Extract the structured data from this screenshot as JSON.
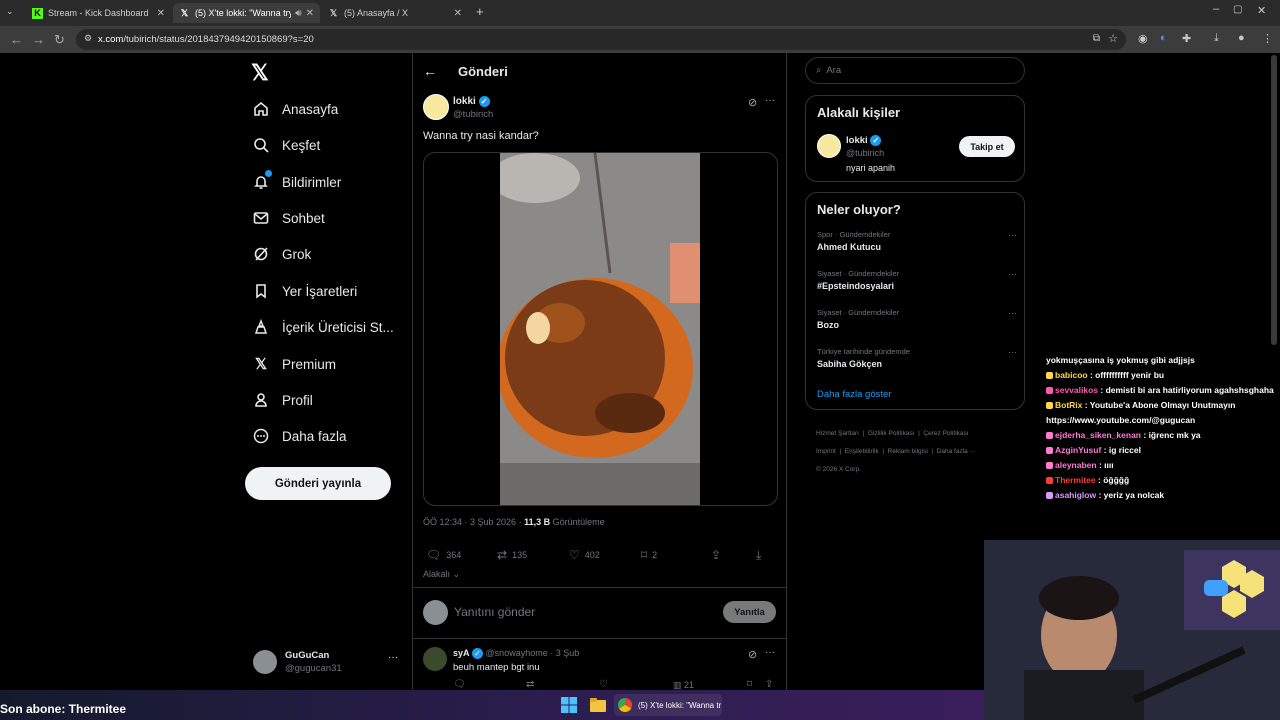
{
  "browser": {
    "tabs": [
      {
        "title": "Stream - Kick Dashboard",
        "active": false,
        "favicon": "kick-icon"
      },
      {
        "title": "(5) X'te lokki: \"Wanna try n",
        "active": true,
        "favicon": "x-icon"
      },
      {
        "title": "(5) Anasayfa / X",
        "active": false,
        "favicon": "x-icon"
      }
    ],
    "url_host": "x.com",
    "url_path": "/tubirich/status/2018437949420150869?s=20"
  },
  "sidebar": {
    "items": [
      {
        "label": "Anasayfa",
        "icon": "home-icon"
      },
      {
        "label": "Keşfet",
        "icon": "search-icon"
      },
      {
        "label": "Bildirimler",
        "icon": "bell-icon"
      },
      {
        "label": "Sohbet",
        "icon": "mail-icon"
      },
      {
        "label": "Grok",
        "icon": "grok-icon"
      },
      {
        "label": "Yer İşaretleri",
        "icon": "bookmark-icon"
      },
      {
        "label": "İçerik Üreticisi St...",
        "icon": "creator-studio-icon"
      },
      {
        "label": "Premium",
        "icon": "x-icon"
      },
      {
        "label": "Profil",
        "icon": "person-icon"
      },
      {
        "label": "Daha fazla",
        "icon": "more-circle-icon"
      }
    ],
    "post_button": "Gönderi yayınla",
    "account": {
      "name": "GuGuCan",
      "handle": "@gugucan31"
    }
  },
  "center": {
    "header": "Gönderi",
    "post": {
      "author": "lokki",
      "handle": "@tubirich",
      "text": "Wanna try nasi kandar?",
      "time": "ÖÖ 12:34 · 3 Şub 2026 · ",
      "views": "11,3 B",
      "views_label": " Görüntüleme",
      "replies": "364",
      "reposts": "135",
      "likes": "402",
      "bookmarks": "2"
    },
    "relevant_label": "Alakalı",
    "reply_placeholder": "Yanıtını gönder",
    "reply_button": "Yanıtla",
    "reply": {
      "author": "syA",
      "handle": "@snowayhome · 3 Şub",
      "text": "beuh mantep bgt inu",
      "views": "21"
    }
  },
  "right": {
    "search_placeholder": "Ara",
    "relevant_people": {
      "title": "Alakalı kişiler",
      "name": "lokki",
      "handle": "@tubirich",
      "bio": "nyari apanih",
      "follow": "Takip et"
    },
    "trends": {
      "title": "Neler oluyor?",
      "items": [
        {
          "category": "Spor · Gündemdekiler",
          "topic": "Ahmed Kutucu"
        },
        {
          "category": "Siyaset · Gündemdekiler",
          "topic": "#Epsteindosyalari"
        },
        {
          "category": "Siyaset · Gündemdekiler",
          "topic": "Bozo"
        },
        {
          "category": "Türkiye tarihinde gündemde",
          "topic": "Sabiha Gökçen"
        }
      ],
      "show_more": "Daha fazla göster"
    },
    "footer": {
      "terms": "Hizmet Şartları",
      "privacy": "Gizlilik Politikası",
      "cookies": "Çerez Politikası",
      "imprint": "Imprint",
      "accessibility": "Erişilebilirlik",
      "ads": "Reklam bilgisi",
      "more": "Daha fazla ···",
      "copyright": "© 2026 X Corp."
    }
  },
  "chat": {
    "messages": [
      {
        "user": "",
        "text": "yokmuşçasına iş yokmuş gibi adjjsjs",
        "color": "#ffffff"
      },
      {
        "user": "babicoo",
        "text": ": offffffffff yenir bu",
        "color": "#ffd84d"
      },
      {
        "user": "sevvalikos",
        "text": ": demisti bi ara hatirliyorum agahshsghaha",
        "color": "#ff5ab0"
      },
      {
        "user": "BotRix",
        "text": ": Youtube'a Abone Olmayı Unutmayın https://www.youtube.com/@gugucan",
        "color": "#ffd84d"
      },
      {
        "user": "ejderha_siken_kenan",
        "text": ": iğrenc mk ya",
        "color": "#ff7bd5"
      },
      {
        "user": "AzginYusuf",
        "text": ": ig riccel",
        "color": "#ff7bd5"
      },
      {
        "user": "aleynaben",
        "text": ": ıııı",
        "color": "#ff7bd5"
      },
      {
        "user": "Thermitee",
        "text": ": öğğğğ",
        "color": "#ff3b3b"
      },
      {
        "user": "asahiglow",
        "text": ": yeriz ya nolcak",
        "color": "#d79aff"
      }
    ]
  },
  "overlay": {
    "subscriber": "Son abone: Thermitee"
  },
  "taskbar": {
    "active_app": "(5) X'te lokki: \"Wanna tr"
  }
}
